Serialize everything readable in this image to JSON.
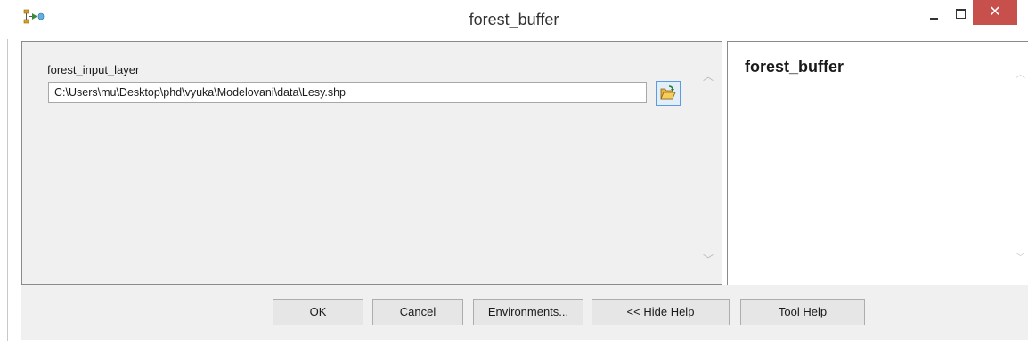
{
  "window": {
    "title": "forest_buffer",
    "close_glyph": "✕",
    "icon": "model-tool-icon"
  },
  "parameters": [
    {
      "label": "forest_input_layer",
      "value": "C:\\Users\\mu\\Desktop\\phd\\vyuka\\Modelovani\\data\\Lesy.shp"
    }
  ],
  "help_panel": {
    "title": "forest_buffer"
  },
  "buttons": {
    "ok": "OK",
    "cancel": "Cancel",
    "environments": "Environments...",
    "hide_help": "<< Hide Help",
    "tool_help": "Tool Help"
  },
  "colors": {
    "close_button": "#c7504c",
    "panel_bg": "#f0f0f0",
    "browse_border": "#5d9be0"
  }
}
